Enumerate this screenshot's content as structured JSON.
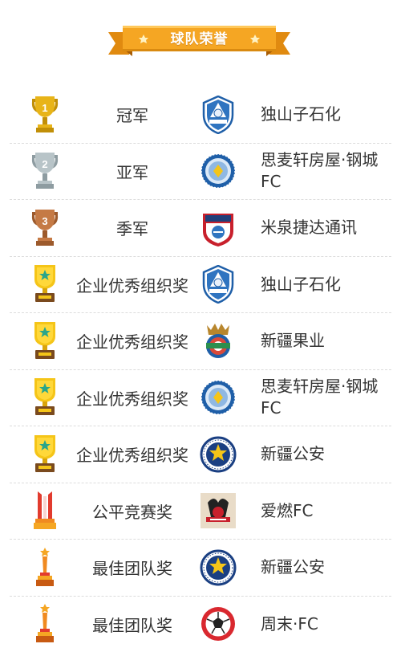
{
  "header": {
    "title": "球队荣誉"
  },
  "honors": [
    {
      "award": "冠军",
      "team": "独山子石化",
      "trophy": "gold-cup",
      "logo": "shield-blue"
    },
    {
      "award": "亚军",
      "team": "思麦轩房屋·钢城FC",
      "trophy": "silver-cup",
      "logo": "round-blue"
    },
    {
      "award": "季军",
      "team": "米泉捷达通讯",
      "trophy": "bronze-cup",
      "logo": "shield-red"
    },
    {
      "award": "企业优秀组织奖",
      "team": "独山子石化",
      "trophy": "star-plaque",
      "logo": "shield-blue"
    },
    {
      "award": "企业优秀组织奖",
      "team": "新疆果业",
      "trophy": "star-plaque",
      "logo": "crown-ball"
    },
    {
      "award": "企业优秀组织奖",
      "team": "思麦轩房屋·钢城FC",
      "trophy": "star-plaque",
      "logo": "round-blue"
    },
    {
      "award": "企业优秀组织奖",
      "team": "新疆公安",
      "trophy": "star-plaque",
      "logo": "police-badge"
    },
    {
      "award": "公平竞赛奖",
      "team": "爱燃FC",
      "trophy": "red-flag-trophy",
      "logo": "airan-square"
    },
    {
      "award": "最佳团队奖",
      "team": "新疆公安",
      "trophy": "torch-trophy",
      "logo": "police-badge"
    },
    {
      "award": "最佳团队奖",
      "team": "周末·FC",
      "trophy": "torch-trophy",
      "logo": "red-ball"
    }
  ],
  "colors": {
    "ribbon": "#f5a623",
    "gold": "#e8b418",
    "silver": "#b8c4c8",
    "bronze": "#c57a45",
    "divider": "#dcdcdc"
  }
}
